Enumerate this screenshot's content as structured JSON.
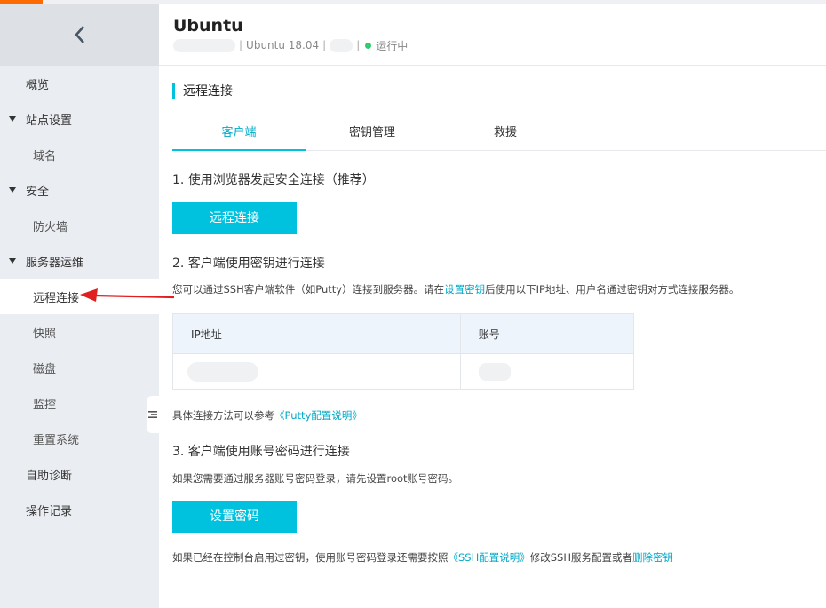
{
  "sidebar": {
    "back_icon": "chevron-left-icon",
    "items": [
      {
        "label": "概览",
        "kind": "top"
      },
      {
        "label": "站点设置",
        "kind": "group"
      },
      {
        "label": "域名",
        "kind": "sub"
      },
      {
        "label": "安全",
        "kind": "group"
      },
      {
        "label": "防火墙",
        "kind": "sub"
      },
      {
        "label": "服务器运维",
        "kind": "group"
      },
      {
        "label": "远程连接",
        "kind": "sub",
        "active": true
      },
      {
        "label": "快照",
        "kind": "sub"
      },
      {
        "label": "磁盘",
        "kind": "sub"
      },
      {
        "label": "监控",
        "kind": "sub"
      },
      {
        "label": "重置系统",
        "kind": "sub"
      },
      {
        "label": "自助诊断",
        "kind": "top"
      },
      {
        "label": "操作记录",
        "kind": "top"
      }
    ]
  },
  "header": {
    "title": "Ubuntu",
    "os": "Ubuntu  18.04",
    "status": "运行中",
    "separator": "|"
  },
  "section": {
    "title": "远程连接"
  },
  "tabs": [
    {
      "label": "客户端",
      "active": true
    },
    {
      "label": "密钥管理",
      "active": false
    },
    {
      "label": "救援",
      "active": false
    }
  ],
  "step1": {
    "title": "1. 使用浏览器发起安全连接（推荐）",
    "button": "远程连接"
  },
  "step2": {
    "title": "2. 客户端使用密钥进行连接",
    "desc_prefix": "您可以通过SSH客户端软件（如Putty）连接到服务器。请在",
    "desc_link": "设置密钥",
    "desc_suffix": "后使用以下IP地址、用户名通过密钥对方式连接服务器。",
    "table": {
      "headers": [
        "IP地址",
        "账号"
      ]
    },
    "ref_prefix": "具体连接方法可以参考",
    "ref_link": "《Putty配置说明》"
  },
  "step3": {
    "title": "3. 客户端使用账号密码进行连接",
    "desc": "如果您需要通过服务器账号密码登录，请先设置root账号密码。",
    "button": "设置密码",
    "note_prefix": "如果已经在控制台启用过密钥，使用账号密码登录还需要按照",
    "note_link1": "《SSH配置说明》",
    "note_middle": "修改SSH服务配置或者",
    "note_link2": "删除密钥"
  },
  "colors": {
    "accent": "#00c1de",
    "brand_orange": "#ff6a00",
    "status_green": "#2ecc71",
    "annotation_red": "#e02020"
  }
}
